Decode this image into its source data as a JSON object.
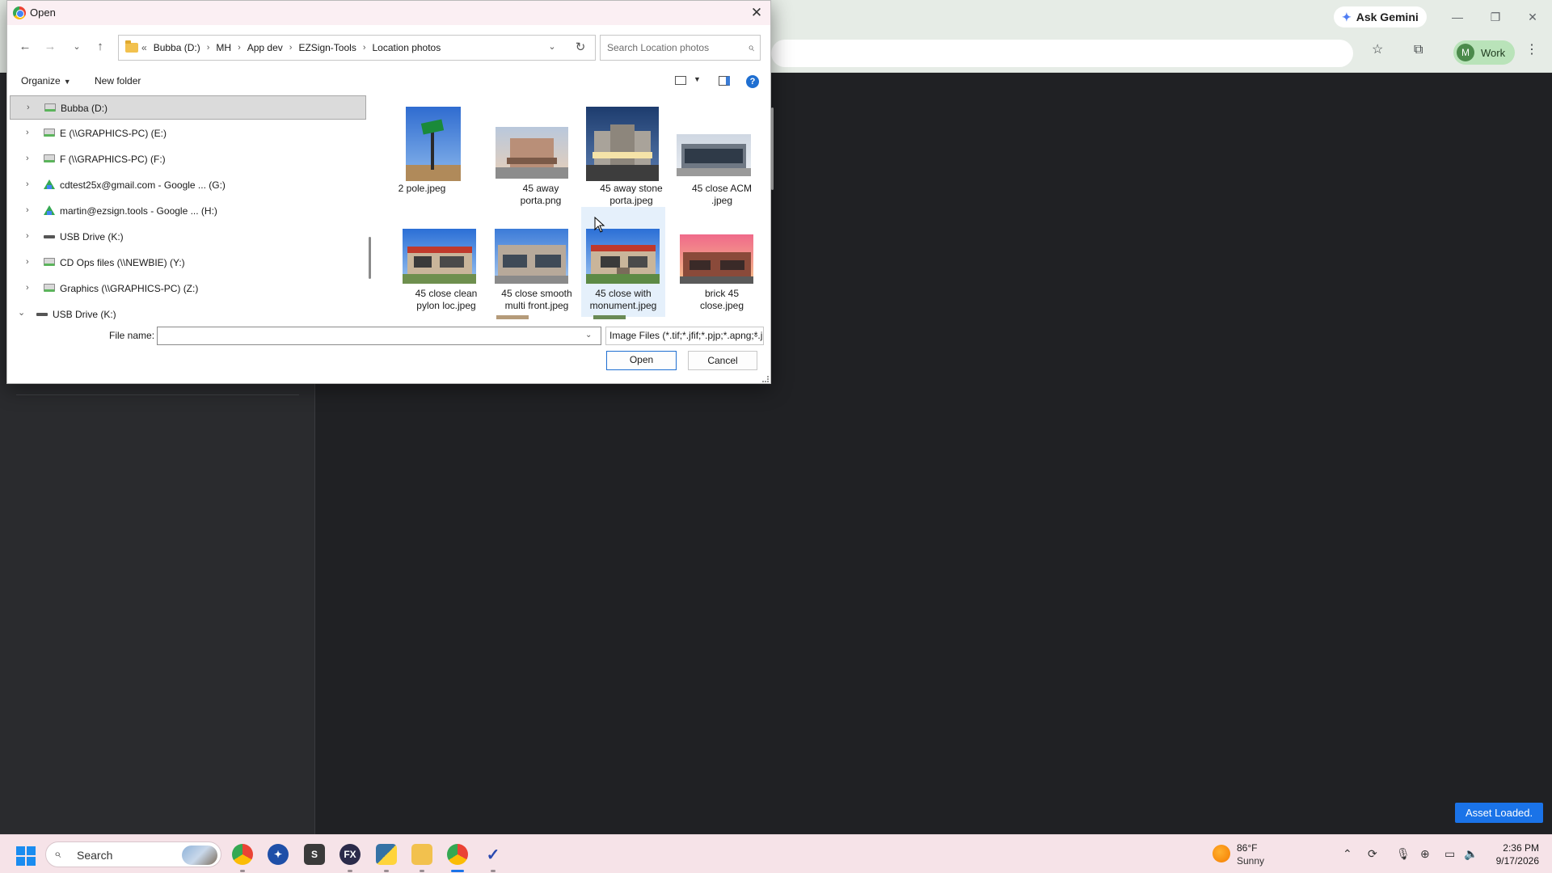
{
  "browser": {
    "ask_gemini_label": "Ask Gemini",
    "profile_initial": "M",
    "profile_label": "Work",
    "toast": "Asset Loaded."
  },
  "dialog": {
    "title": "Open",
    "breadcrumb_lead": "«",
    "breadcrumb": [
      "Bubba (D:)",
      "MH",
      "App dev",
      "EZSign-Tools",
      "Location photos"
    ],
    "search_placeholder": "Search Location photos",
    "organize_label": "Organize",
    "new_folder_label": "New folder",
    "help_glyph": "?",
    "nav_items": [
      {
        "label": "Bubba (D:)",
        "icon": "drive-icon",
        "expanded": false,
        "selected": true
      },
      {
        "label": "E (\\\\GRAPHICS-PC) (E:)",
        "icon": "network-drive-icon",
        "expanded": false
      },
      {
        "label": "F (\\\\GRAPHICS-PC) (F:)",
        "icon": "network-drive-icon",
        "expanded": false
      },
      {
        "label": "cdtest25x@gmail.com - Google ... (G:)",
        "icon": "google-drive-icon",
        "expanded": false
      },
      {
        "label": "martin@ezsign.tools - Google ... (H:)",
        "icon": "google-drive-icon",
        "expanded": false
      },
      {
        "label": "USB Drive (K:)",
        "icon": "usb-drive-icon",
        "expanded": false
      },
      {
        "label": "CD Ops files (\\\\NEWBIE) (Y:)",
        "icon": "network-drive-icon",
        "expanded": false
      },
      {
        "label": "Graphics (\\\\GRAPHICS-PC) (Z:)",
        "icon": "network-drive-icon",
        "expanded": false
      },
      {
        "label": "USB Drive (K:)",
        "icon": "usb-drive-icon",
        "expanded": true
      }
    ],
    "files": [
      {
        "line1": "2 pole.jpeg",
        "line2": "",
        "thumb": "pole-sign"
      },
      {
        "line1": "45 away",
        "line2": "porta.png",
        "thumb": "hotel-dusk"
      },
      {
        "line1": "45 away stone",
        "line2": "porta.jpeg",
        "thumb": "hotel-night"
      },
      {
        "line1": "45 close ACM",
        "line2": ".jpeg",
        "thumb": "acm-building"
      },
      {
        "line1": "45 close clean",
        "line2": "pylon loc.jpeg",
        "thumb": "retail-pylon"
      },
      {
        "line1": "45 close smooth",
        "line2": "multi front.jpeg",
        "thumb": "multi-front"
      },
      {
        "line1": "45 close with",
        "line2": "monument.jpeg",
        "thumb": "retail-monument"
      },
      {
        "line1": "brick 45",
        "line2": "close.jpeg",
        "thumb": "brick-sunset"
      }
    ],
    "file_name_label": "File name:",
    "file_name_value": "",
    "filter_value": "Image Files (*.tif;*.jfif;*.pjp;*.apng;*.jpeg;*.png;*.gif;*.jpg)",
    "open_label": "Open",
    "cancel_label": "Cancel"
  },
  "taskbar": {
    "search_label": "Search",
    "apps": [
      "chrome-icon",
      "sketch-icon",
      "s-app-icon",
      "fx-app-icon",
      "python-icon",
      "file-explorer-icon",
      "chrome-active-icon",
      "v-app-icon"
    ],
    "weather_temp": "86°F",
    "weather_desc": "Sunny",
    "time": "2:36 PM",
    "date": "9/17/2026"
  },
  "colors": {
    "accent": "#1f6fd1",
    "toast_bg": "#1a73e8",
    "taskbar_bg": "#f6e3e8",
    "dialog_title_bg": "#fbeff3"
  }
}
